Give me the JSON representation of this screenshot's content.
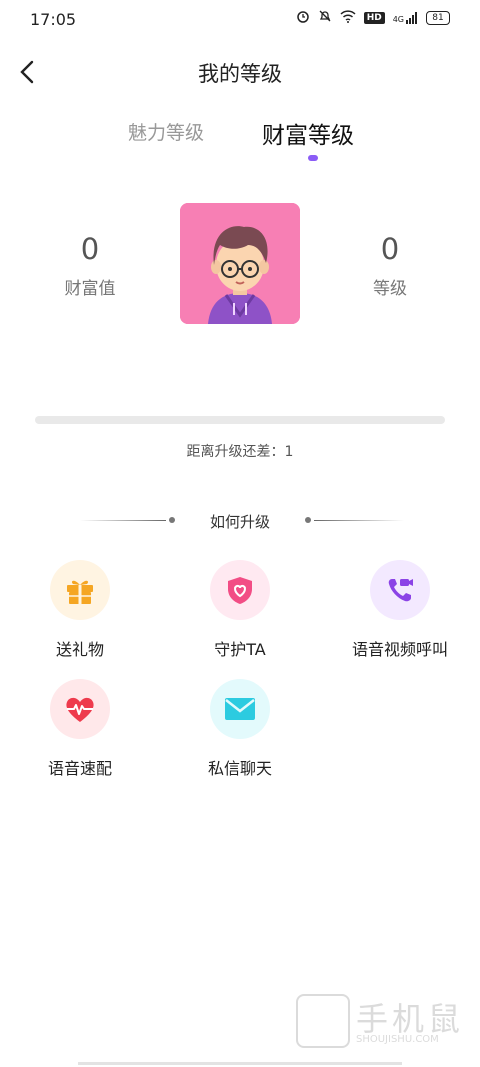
{
  "status_bar": {
    "time": "17:05",
    "hd": "HD",
    "network": "4G",
    "battery": "81"
  },
  "header": {
    "title": "我的等级"
  },
  "tabs": [
    {
      "label": "魅力等级",
      "active": false
    },
    {
      "label": "财富等级",
      "active": true
    }
  ],
  "profile": {
    "wealth_value": "0",
    "wealth_label": "财富值",
    "level_value": "0",
    "level_label": "等级",
    "progress": 0,
    "progress_text": "距离升级还差：1"
  },
  "upgrade": {
    "title": "如何升级",
    "features": [
      {
        "label": "送礼物",
        "icon": "gift-icon"
      },
      {
        "label": "守护TA",
        "icon": "shield-heart-icon"
      },
      {
        "label": "语音视频呼叫",
        "icon": "video-call-icon"
      },
      {
        "label": "语音速配",
        "icon": "heart-pulse-icon"
      },
      {
        "label": "私信聊天",
        "icon": "envelope-icon"
      }
    ]
  },
  "watermark": {
    "text": "手机鼠",
    "sub": "SHOUJISHU.COM"
  },
  "colors": {
    "accent": "#8b5cf6",
    "avatar_bg": "#f77fb4"
  }
}
